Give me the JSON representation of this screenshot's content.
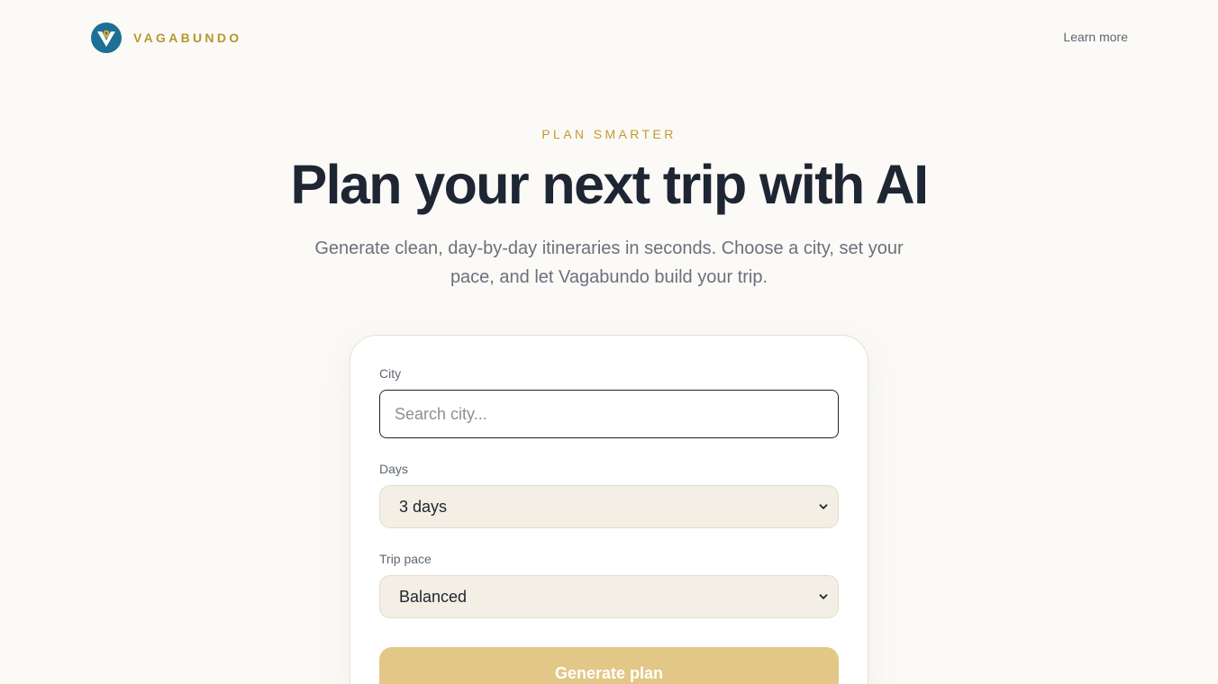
{
  "header": {
    "brand_name": "VAGABUNDO",
    "learn_more": "Learn more"
  },
  "hero": {
    "eyebrow": "PLAN SMARTER",
    "title": "Plan your next trip with AI",
    "subtitle": "Generate clean, day-by-day itineraries in seconds. Choose a city, set your pace, and let Vagabundo build your trip."
  },
  "form": {
    "city_label": "City",
    "city_placeholder": "Search city...",
    "city_value": "",
    "days_label": "Days",
    "days_selected": "3 days",
    "pace_label": "Trip pace",
    "pace_selected": "Balanced",
    "submit_label": "Generate plan"
  },
  "colors": {
    "brand_gold": "#b8962e",
    "logo_blue": "#1d6f96",
    "button_gold": "#e2c786",
    "title_navy": "#1e2533",
    "page_bg": "#fbfaf7",
    "select_bg": "#f3efe4"
  },
  "icons": {
    "logo": "vagabundo-logo-icon",
    "select_caret": "chevron-down-icon"
  }
}
